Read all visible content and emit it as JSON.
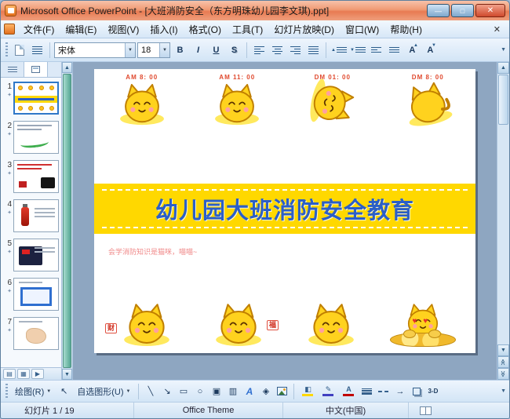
{
  "window": {
    "title": "Microsoft Office PowerPoint - [大班消防安全（东方明珠幼儿园李文琪).ppt]"
  },
  "icons": {
    "minimize": "—",
    "maximize": "□",
    "close": "✕",
    "dropdown": "▼",
    "tri_up": "▲",
    "tri_down": "▼",
    "scroll_up": "▲",
    "scroll_down": "▼",
    "star": "✦",
    "heart": "♥",
    "pointer": "↖",
    "line": "╲",
    "arrow": "↘",
    "rect": "▭",
    "oval": "○",
    "textbox": "▣",
    "vtextbox": "▥",
    "diagram": "◈",
    "wordart": "A",
    "arrow_style": "→",
    "three_d": "3-D",
    "view_normal": "▤",
    "view_sorter": "▦",
    "view_show": "▶",
    "prev_slide": "≪",
    "next_slide": "≫"
  },
  "menu": {
    "items": [
      {
        "label": "文件(F)"
      },
      {
        "label": "编辑(E)"
      },
      {
        "label": "视图(V)"
      },
      {
        "label": "插入(I)"
      },
      {
        "label": "格式(O)"
      },
      {
        "label": "工具(T)"
      },
      {
        "label": "幻灯片放映(D)"
      },
      {
        "label": "窗口(W)"
      },
      {
        "label": "帮助(H)"
      }
    ]
  },
  "toolbar": {
    "font_name": "宋体",
    "font_size": "18",
    "bold": "B",
    "italic": "I",
    "underline": "U",
    "shadow": "S",
    "font_grow": "A",
    "font_shrink": "A"
  },
  "sidebar": {
    "slides": [
      {
        "number": "1"
      },
      {
        "number": "2"
      },
      {
        "number": "3"
      },
      {
        "number": "4"
      },
      {
        "number": "5"
      },
      {
        "number": "6"
      },
      {
        "number": "7"
      }
    ]
  },
  "slide": {
    "times": [
      "AM 8: 00",
      "AM 11: 00",
      "DM 01: 00",
      "DM 8: 00"
    ],
    "title": "幼儿园大班消防安全教育",
    "note": "会学消防知识是猫咪，喵喵~",
    "sign_cai": "财",
    "sign_fu": "福"
  },
  "drawbar": {
    "draw_label": "绘图(R)",
    "autoshapes_label": "自选图形(U)"
  },
  "statusbar": {
    "slide_indicator": "幻灯片 1 / 19",
    "theme": "Office Theme",
    "language": "中文(中国)"
  }
}
